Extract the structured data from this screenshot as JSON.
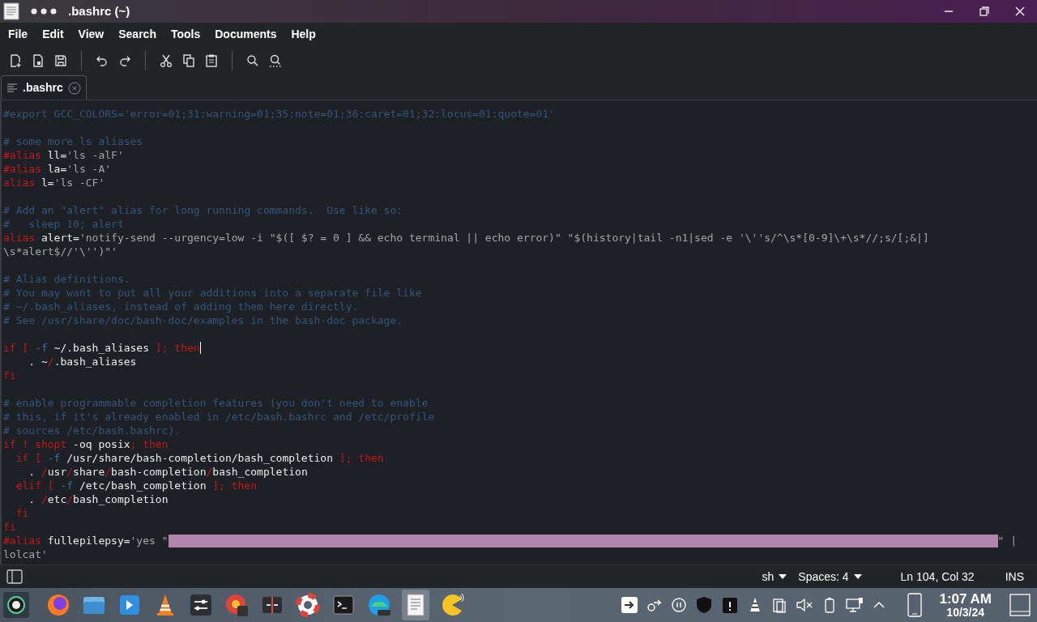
{
  "window": {
    "title": ".bashrc (~)"
  },
  "menu": [
    "File",
    "Edit",
    "View",
    "Search",
    "Tools",
    "Documents",
    "Help"
  ],
  "tabs": [
    {
      "label": ".bashrc",
      "selected": true
    }
  ],
  "editor": {
    "lines": [
      {
        "segments": [
          {
            "kind": "comment",
            "text": "#export GCC_COLORS='error=01;31:warning=01;35:note=01;36:caret=01;32:locus=01:quote=01'"
          }
        ]
      },
      {
        "segments": [
          {
            "kind": "blank"
          }
        ]
      },
      {
        "segments": [
          {
            "kind": "comment",
            "text": "# some more ls aliases"
          }
        ]
      },
      {
        "segments": [
          {
            "kind": "keyword",
            "text": "#alias"
          },
          {
            "kind": "text",
            "text": " ll="
          },
          {
            "kind": "string",
            "text": "'ls -alF'"
          }
        ]
      },
      {
        "segments": [
          {
            "kind": "keyword",
            "text": "#alias"
          },
          {
            "kind": "text",
            "text": " la="
          },
          {
            "kind": "string",
            "text": "'ls -A'"
          }
        ]
      },
      {
        "segments": [
          {
            "kind": "keyword",
            "text": "alias"
          },
          {
            "kind": "text",
            "text": " l="
          },
          {
            "kind": "string",
            "text": "'ls -CF'"
          }
        ]
      },
      {
        "segments": [
          {
            "kind": "blank"
          }
        ]
      },
      {
        "segments": [
          {
            "kind": "comment",
            "text": "# Add an \"alert\" alias for long running commands.  Use like so:"
          }
        ]
      },
      {
        "segments": [
          {
            "kind": "comment",
            "text": "#   sleep 10; alert"
          }
        ]
      },
      {
        "segments": [
          {
            "kind": "keyword",
            "text": "alias"
          },
          {
            "kind": "text",
            "text": " alert="
          },
          {
            "kind": "string",
            "text": "'notify-send --urgency=low -i \"$([ $? = 0 ] && echo terminal || echo error)\" \"$(history|tail -n1|sed -e '\\''s/^\\s*[0-9]\\+\\s*//;s/[;&|]"
          }
        ]
      },
      {
        "segments": [
          {
            "kind": "string",
            "text": "\\s*alert$//'\\'')\"'"
          }
        ]
      },
      {
        "segments": [
          {
            "kind": "blank"
          }
        ]
      },
      {
        "segments": [
          {
            "kind": "comment",
            "text": "# Alias definitions."
          }
        ]
      },
      {
        "segments": [
          {
            "kind": "comment",
            "text": "# You may want to put all your additions into a separate file like"
          }
        ]
      },
      {
        "segments": [
          {
            "kind": "comment",
            "text": "# ~/.bash_aliases, instead of adding them here directly."
          }
        ]
      },
      {
        "segments": [
          {
            "kind": "comment",
            "text": "# See /usr/share/doc/bash-doc/examples in the bash-doc package."
          }
        ]
      },
      {
        "segments": [
          {
            "kind": "blank"
          }
        ]
      },
      {
        "segments": [
          {
            "kind": "keyword",
            "text": "if [ "
          },
          {
            "kind": "option",
            "text": "-f"
          },
          {
            "kind": "text",
            "text": " ~/.bash_aliases "
          },
          {
            "kind": "keyword",
            "text": "]; then"
          },
          {
            "kind": "cursor"
          }
        ]
      },
      {
        "segments": [
          {
            "kind": "text",
            "text": "    . ~"
          },
          {
            "kind": "keyword",
            "text": "/"
          },
          {
            "kind": "text",
            "text": ".bash_aliases"
          }
        ]
      },
      {
        "segments": [
          {
            "kind": "keyword",
            "text": "fi"
          }
        ]
      },
      {
        "segments": [
          {
            "kind": "blank"
          }
        ]
      },
      {
        "segments": [
          {
            "kind": "comment",
            "text": "# enable programmable completion features (you don't need to enable"
          }
        ]
      },
      {
        "segments": [
          {
            "kind": "comment",
            "text": "# this, if it's already enabled in /etc/bash.bashrc and /etc/profile"
          }
        ]
      },
      {
        "segments": [
          {
            "kind": "comment",
            "text": "# sources /etc/bash.bashrc)."
          }
        ]
      },
      {
        "segments": [
          {
            "kind": "keyword",
            "text": "if ! shopt"
          },
          {
            "kind": "text",
            "text": " -oq posix"
          },
          {
            "kind": "keyword",
            "text": "; then"
          }
        ]
      },
      {
        "segments": [
          {
            "kind": "keyword",
            "text": "  if [ "
          },
          {
            "kind": "option",
            "text": "-f"
          },
          {
            "kind": "text",
            "text": " /usr/share/bash-completion/bash_completion "
          },
          {
            "kind": "keyword",
            "text": "]; then"
          }
        ]
      },
      {
        "segments": [
          {
            "kind": "text",
            "text": "    . "
          },
          {
            "kind": "keyword",
            "text": "/"
          },
          {
            "kind": "text",
            "text": "usr"
          },
          {
            "kind": "keyword",
            "text": "/"
          },
          {
            "kind": "text",
            "text": "share"
          },
          {
            "kind": "keyword",
            "text": "/"
          },
          {
            "kind": "text",
            "text": "bash-completion"
          },
          {
            "kind": "keyword",
            "text": "/"
          },
          {
            "kind": "text",
            "text": "bash_completion"
          }
        ]
      },
      {
        "segments": [
          {
            "kind": "keyword",
            "text": "  elif [ "
          },
          {
            "kind": "option",
            "text": "-f"
          },
          {
            "kind": "text",
            "text": " /etc/bash_completion "
          },
          {
            "kind": "keyword",
            "text": "]; then"
          }
        ]
      },
      {
        "segments": [
          {
            "kind": "text",
            "text": "    . "
          },
          {
            "kind": "keyword",
            "text": "/"
          },
          {
            "kind": "text",
            "text": "etc"
          },
          {
            "kind": "keyword",
            "text": "/"
          },
          {
            "kind": "text",
            "text": "bash_completion"
          }
        ]
      },
      {
        "segments": [
          {
            "kind": "keyword",
            "text": "  fi"
          }
        ]
      },
      {
        "segments": [
          {
            "kind": "keyword",
            "text": "fi"
          }
        ]
      },
      {
        "segments": [
          {
            "kind": "keyword",
            "text": "#alias"
          },
          {
            "kind": "text",
            "text": " fullepilepsy="
          },
          {
            "kind": "string",
            "text": "'yes \""
          },
          {
            "kind": "highlight"
          },
          {
            "kind": "string",
            "text": "\" |"
          }
        ]
      },
      {
        "segments": [
          {
            "kind": "string",
            "text": "lolcat'"
          }
        ]
      }
    ]
  },
  "status_bar": {
    "language": "sh",
    "indent": "Spaces: 4",
    "position": "Ln 104, Col 32",
    "mode": "INS"
  },
  "taskbar": {
    "time": "1:07 AM",
    "date": "10/3/24"
  }
}
